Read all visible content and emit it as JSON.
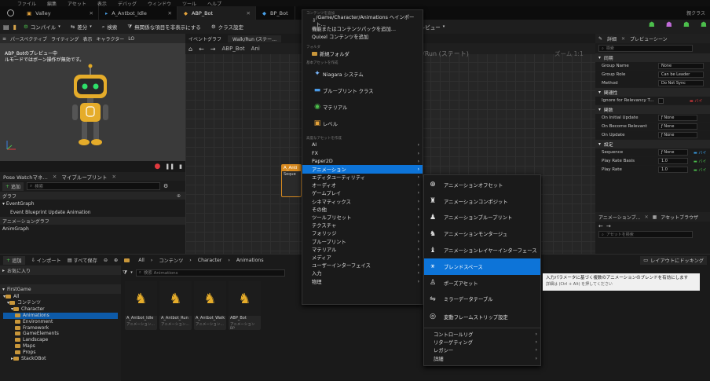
{
  "menubar": {
    "items": [
      "ファイル",
      "編集",
      "アセット",
      "表示",
      "デバッグ",
      "ウィンドウ",
      "ツール",
      "ヘルプ"
    ]
  },
  "tabs": [
    {
      "label": "Valley"
    },
    {
      "label": "A_Antbot_Idle"
    },
    {
      "label": "ABP_Bot"
    },
    {
      "label": "BP_Bot"
    }
  ],
  "tabbar_right": "親クラス",
  "toolbar": {
    "compile": "コンパイル",
    "diff": "差分",
    "search": "検索",
    "hide_unrelated": "無関係な項目を非表示にする",
    "class_settings": "クラス設定",
    "preview_instance": "インスタンスをプレビュー"
  },
  "viewport": {
    "perspective": "パースペクティブ",
    "lighting": "ライティング",
    "show": "表示",
    "character": "キャラクター",
    "lo": "LO",
    "preview_line1": "ABP_Botのプレビュー中",
    "preview_line2": "ルモードではボーン操作が無効です。"
  },
  "left_panel": {
    "tab1": "Pose Watchマネ…",
    "tab2": "マイブループリント",
    "add": "追加",
    "search_placeholder": "検索",
    "graph_header": "グラフ",
    "event_graph": "EventGraph",
    "event_update": "Event Blueprint Update Animation",
    "anim_graph_header": "アニメーショングラフ",
    "anim_graph": "AnimGraph"
  },
  "graph": {
    "tab_event": "イベントグラフ",
    "tab_walk": "Walk/Run (ステー…",
    "breadcrumb": "ABP_Bot",
    "breadcrumb_2": "Ani",
    "state_title": "/Run (ステート)",
    "zoom": "ズーム 1:1",
    "node_title": "A_Anti",
    "node_sub": "Seque"
  },
  "details": {
    "tab_details": "詳細",
    "tab_preview": "プレビューシーン",
    "search": "検索",
    "sections": [
      {
        "name": "同期",
        "props": [
          {
            "label": "Group Name",
            "value": "None"
          },
          {
            "label": "Group Role",
            "value": "Can be Leader"
          },
          {
            "label": "Method",
            "value": "Do Not Sync"
          }
        ]
      },
      {
        "name": "関連性",
        "props": [
          {
            "label": "Ignore for Relevancy T...",
            "value": ""
          }
        ]
      },
      {
        "name": "関数",
        "props": [
          {
            "label": "On Initial Update",
            "value": "None"
          },
          {
            "label": "On Become Relevant",
            "value": "None"
          },
          {
            "label": "On Update",
            "value": "None"
          }
        ]
      },
      {
        "name": "設定",
        "props": [
          {
            "label": "Sequence",
            "value": ""
          },
          {
            "label": "Play Rate Basis",
            "value": "1.0"
          },
          {
            "label": "Play Rate",
            "value": "1.0"
          }
        ]
      }
    ],
    "bind_label": "バイ"
  },
  "anim_browser": {
    "tab1": "アニメーションブ…",
    "tab2": "アセットブラウザ",
    "search": "アセットを検索"
  },
  "content_browser": {
    "add": "追加",
    "import": "インポート",
    "save_all": "すべて保存",
    "crumbs": [
      "All",
      "コンテンツ",
      "Character",
      "Animations"
    ],
    "layout": "レイアウトにドッキング",
    "favorites": "お気に入り",
    "project": "FirstGame",
    "search_placeholder": "検索 Animations",
    "tree": [
      "All",
      "コンテンツ",
      "Character",
      "Animations",
      "Environment",
      "Framework",
      "GameElements",
      "Landscape",
      "Maps",
      "Props",
      "StackOBot"
    ],
    "assets": [
      {
        "name": "A_Antbot_Idle",
        "type": "アニメーション…"
      },
      {
        "name": "A_Antbot_Run",
        "type": "アニメーション…"
      },
      {
        "name": "A_Antbot_Walk",
        "type": "アニメーション…"
      },
      {
        "name": "ABP_Bot",
        "type": "アニメーションBP"
      }
    ]
  },
  "context_menu": {
    "header_path": "コンテンツを追加",
    "import_to": "/Game/Character/Animations へインポート…",
    "add_feature": "機能またはコンテンツパックを追加…",
    "quixel": "Quixel コンテンツを追加",
    "folder_header": "フォルダ",
    "new_folder": "新規フォルダ",
    "basic_header": "基本アセットを作成",
    "niagara": "Niagara システム",
    "blueprint": "ブループリント クラス",
    "material": "マテリアル",
    "level": "レベル",
    "advanced_header": "高度なアセットを作成",
    "categories": [
      "AI",
      "FX",
      "Paper2D",
      "アニメーション",
      "エディタユーティリティ",
      "オーディオ",
      "ゲームプレイ",
      "シネマティックス",
      "その他",
      "ツールプリセット",
      "テクスチャ",
      "フォリッジ",
      "ブループリント",
      "マテリアル",
      "メディア",
      "ユーザーインターフェイス",
      "入力",
      "物理"
    ]
  },
  "submenu": {
    "items": [
      "アニメーションオフセット",
      "アニメーションコンポジット",
      "アニメーションブループリント",
      "アニメーションモンタージュ",
      "アニメーションレイヤーインターフェース",
      "ブレンドスペース",
      "ポーズアセット",
      "ミラーデータテーブル",
      "変動フレームストリップ設定"
    ],
    "more": [
      "コントロールリグ",
      "リターゲティング",
      "レガシー",
      "詳細"
    ]
  },
  "tooltip": {
    "line1": "入力パラメータに基づく複数のアニメーションのブレンドを有効にします",
    "line2": "詳細は (Ctrl + Alt) を押してください"
  },
  "colors": {
    "accent": "#0d74d8",
    "node": "#d88a1f"
  }
}
